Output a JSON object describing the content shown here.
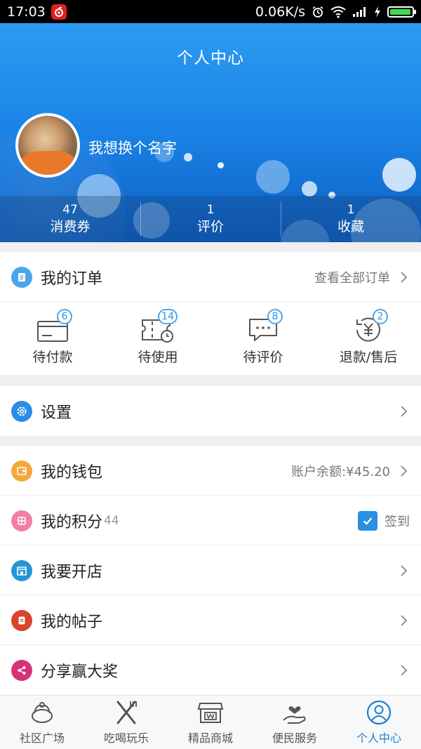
{
  "status_bar": {
    "time": "17:03",
    "speed": "0.06K/s",
    "battery_level": 0.95
  },
  "header": {
    "title": "个人中心",
    "username": "我想换个名字",
    "stats": [
      {
        "value": "47",
        "label": "消费券"
      },
      {
        "value": "1",
        "label": "评价"
      },
      {
        "value": "1",
        "label": "收藏"
      }
    ]
  },
  "orders": {
    "title": "我的订单",
    "view_all": "查看全部订单",
    "items": [
      {
        "label": "待付款",
        "badge": "6",
        "icon": "card-icon"
      },
      {
        "label": "待使用",
        "badge": "14",
        "icon": "ticket-icon"
      },
      {
        "label": "待评价",
        "badge": "8",
        "icon": "comment-icon"
      },
      {
        "label": "退款/售后",
        "badge": "2",
        "icon": "refund-icon"
      }
    ]
  },
  "settings": {
    "label": "设置"
  },
  "menu": {
    "wallet": {
      "label": "我的钱包",
      "detail": "账户余额:¥45.20"
    },
    "points": {
      "label": "我的积分",
      "value": "44",
      "checkin": "签到",
      "checked": true
    },
    "shop": {
      "label": "我要开店"
    },
    "posts": {
      "label": "我的帖子"
    },
    "share": {
      "label": "分享赢大奖"
    }
  },
  "colors": {
    "accent": "#1a7fd8",
    "order_icon": "#4aa7ea",
    "settings_icon": "#2a8ee6",
    "wallet_icon": "#f3a93a",
    "points_icon": "#f07fa6",
    "shop_icon": "#2694d6",
    "posts_icon": "#d9442b",
    "share_icon": "#d8317a"
  },
  "bottom_nav": [
    {
      "label": "社区广场",
      "icon": "community-icon",
      "active": false
    },
    {
      "label": "吃喝玩乐",
      "icon": "fork-knife-icon",
      "active": false
    },
    {
      "label": "精品商城",
      "icon": "store-icon",
      "active": false
    },
    {
      "label": "便民服务",
      "icon": "heart-hand-icon",
      "active": false
    },
    {
      "label": "个人中心",
      "icon": "user-icon",
      "active": true
    }
  ]
}
